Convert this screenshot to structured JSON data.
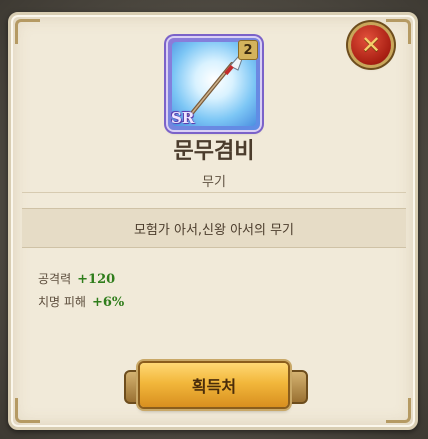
{
  "dialog": {
    "item_name": "문무겸비",
    "item_type": "무기",
    "description": "모험가 아서,신왕 아서의 무기",
    "grade_badge": "2",
    "rarity_badge": "SR",
    "close_symbol": "✕",
    "stats": [
      {
        "label": "공격력",
        "value": "+120"
      },
      {
        "label": "치명 피해",
        "value": "+6%"
      }
    ],
    "acquire_label": "획득처"
  },
  "icons": {
    "item": "spear-weapon-icon",
    "close": "close-icon"
  },
  "colors": {
    "panel_bg": "#f1ead9",
    "stat_value": "#2f7d1b",
    "button_gold": "#f2b73b",
    "close_red": "#a81e12"
  }
}
